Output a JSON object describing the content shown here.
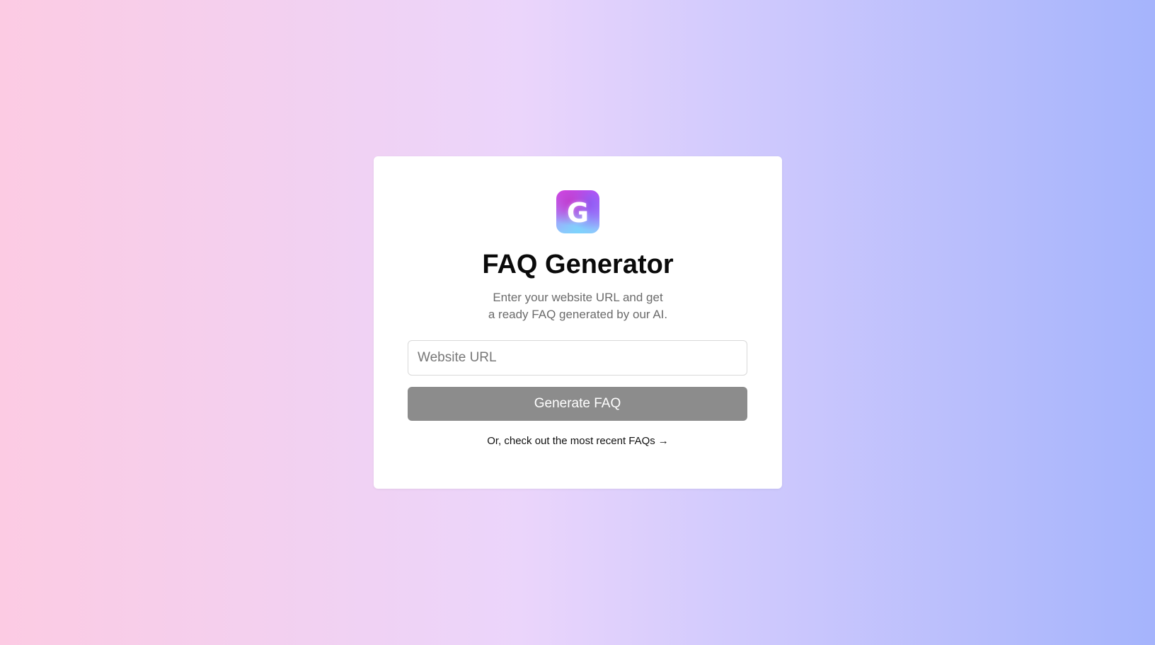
{
  "card": {
    "logo_letter": "G",
    "title": "FAQ Generator",
    "subtitle_line1": "Enter your website URL and get",
    "subtitle_line2": "a ready FAQ generated by our AI.",
    "url_input": {
      "value": "",
      "placeholder": "Website URL"
    },
    "generate_button_label": "Generate FAQ",
    "recent_link_text": "Or, check out the most recent FAQs",
    "recent_link_arrow": "→"
  },
  "colors": {
    "background_gradient": [
      "#fccbe3",
      "#ebd5fb",
      "#d3cbfd",
      "#a5b4fc"
    ],
    "button_disabled": "#8c8c8c",
    "title_text": "#0a0a0a",
    "subtitle_text": "#6b6b6b"
  },
  "icons": {
    "logo": "g-logo-icon",
    "arrow": "arrow-right-icon"
  }
}
